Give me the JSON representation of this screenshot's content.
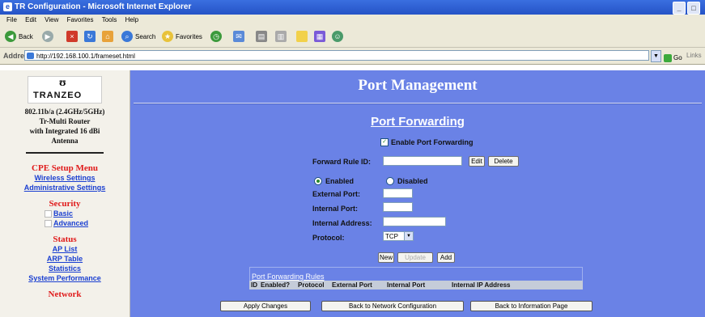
{
  "window": {
    "title": "TR Configuration - Microsoft Internet Explorer"
  },
  "menu": [
    "File",
    "Edit",
    "View",
    "Favorites",
    "Tools",
    "Help"
  ],
  "toolbar": {
    "back": "Back",
    "search": "Search",
    "favorites": "Favorites"
  },
  "address": {
    "label": "Address",
    "url": "http://192.168.100.1/frameset.html",
    "go": "Go",
    "links": "Links"
  },
  "sidebar": {
    "logo": "TRANZEO",
    "description": [
      "802.11b/a (2.4GHz/5GHz)",
      "Tr-Multi Router",
      "with Integrated 16 dBi",
      "Antenna"
    ],
    "menu_title": "CPE Setup Menu",
    "wireless": "Wireless Settings",
    "admin": "Administrative Settings",
    "security_title": "Security",
    "basic": "Basic",
    "advanced": "Advanced",
    "status_title": "Status",
    "ap_list": "AP List",
    "arp_table": "ARP Table",
    "statistics": "Statistics",
    "system_performance": "System Performance",
    "network_title": "Network"
  },
  "main": {
    "title": "Port Management",
    "subtitle": "Port Forwarding",
    "enable_label": "Enable Port Forwarding",
    "forward_rule_id": "Forward Rule ID:",
    "edit": "Edit",
    "delete": "Delete",
    "enabled": "Enabled",
    "disabled": "Disabled",
    "external_port": "External Port:",
    "internal_port": "Internal Port:",
    "internal_address": "Internal Address:",
    "protocol": "Protocol:",
    "protocol_value": "TCP",
    "new": "New",
    "update": "Update",
    "add": "Add",
    "rules_title": "Port Forwarding Rules",
    "columns": [
      "ID",
      "Enabled?",
      "Protocol",
      "External Port",
      "Internal Port",
      "Internal IP Address"
    ],
    "apply": "Apply Changes",
    "back_network": "Back to Network Configuration",
    "back_info": "Back to Information Page"
  }
}
